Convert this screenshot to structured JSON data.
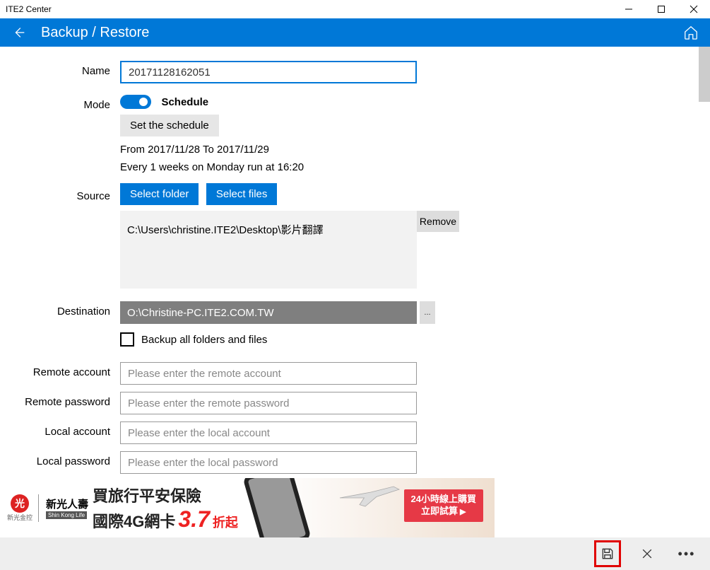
{
  "window": {
    "title": "ITE2 Center"
  },
  "header": {
    "page_title": "Backup / Restore"
  },
  "form": {
    "labels": {
      "name": "Name",
      "mode": "Mode",
      "source": "Source",
      "destination": "Destination",
      "remote_account": "Remote account",
      "remote_password": "Remote password",
      "local_account": "Local account",
      "local_password": "Local password"
    },
    "name_value": "20171128162051",
    "mode": {
      "schedule_label": "Schedule",
      "set_schedule_btn": "Set the schedule",
      "range_text": "From  2017/11/28  To  2017/11/29",
      "recurrence_text": "Every 1 weeks on Monday  run at 16:20"
    },
    "source": {
      "select_folder_btn": "Select folder",
      "select_files_btn": "Select files",
      "path": "C:\\Users\\christine.ITE2\\Desktop\\影片翻譯",
      "remove_btn": "Remove"
    },
    "destination": {
      "path": "O:\\Christine-PC.ITE2.COM.TW",
      "more_btn": "..."
    },
    "backup_all_label": "Backup all folders and files",
    "placeholders": {
      "remote_account": "Please enter the remote account",
      "remote_password": "Please enter the remote password",
      "local_account": "Please enter the local account",
      "local_password": "Please enter the local password"
    }
  },
  "ad": {
    "brand_char": "光",
    "brand": "新光人壽",
    "brand_en": "Shin Kong Life",
    "line1": "買旅行平安保險",
    "line2_pre": "國際4G網卡",
    "big": "3.7",
    "suffix": "折起",
    "red1": "24小時線上購買",
    "red2": "立即試算",
    "sub": "新光金控"
  }
}
